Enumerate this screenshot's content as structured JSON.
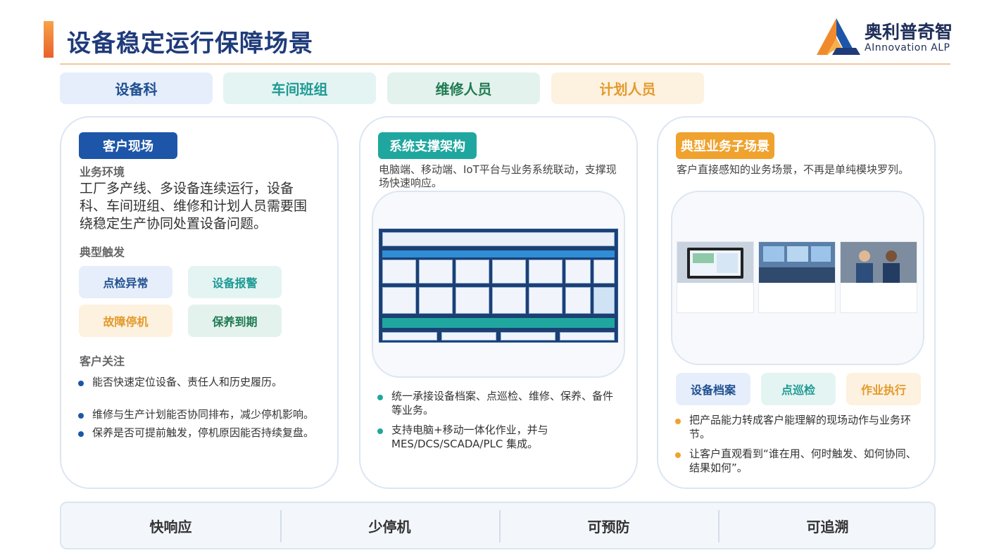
{
  "header": {
    "title": "设备稳定运行保障场景",
    "logo_cn": "奥利普奇智",
    "logo_en": "AInnovation ALP"
  },
  "roles": [
    "设备科",
    "车间班组",
    "维修人员",
    "计划人员"
  ],
  "card1": {
    "badge": "客户现场",
    "env_label": "业务环境",
    "env_text": "工厂多产线、多设备连续运行，设备科、车间班组、维修和计划人员需要围绕稳定生产协同处置设备问题。",
    "trigger_label": "典型触发",
    "triggers": [
      "点检异常",
      "设备报警",
      "故障停机",
      "保养到期"
    ],
    "concern_label": "客户关注",
    "concerns": [
      "能否快速定位设备、责任人和历史履历。",
      "维修与生产计划能否协同排布，减少停机影响。",
      "保养是否可提前触发，停机原因能否持续复盘。"
    ]
  },
  "card2": {
    "badge": "系统支撑架构",
    "desc": "电脑端、移动端、IoT平台与业务系统联动，支撑现场快速响应。",
    "points": [
      "统一承接设备档案、点巡检、维修、保养、备件等业务。",
      "支持电脑+移动一体化作业，并与MES/DCS/SCADA/PLC 集成。"
    ]
  },
  "card3": {
    "badge": "典型业务子场景",
    "desc": "客户直接感知的业务场景，不再是单纯模块罗列。",
    "tags": [
      "设备档案",
      "点巡检",
      "作业执行"
    ],
    "points": [
      "把产品能力转成客户能理解的现场动作与业务环节。",
      "让客户直观看到“谁在用、何时触发、如何协同、结果如何”。"
    ]
  },
  "pillars": [
    "快响应",
    "少停机",
    "可预防",
    "可追溯"
  ],
  "colors": {
    "navy": "#1f3b7a",
    "blue_badge": "#1d56a8",
    "teal_badge": "#1fa79f",
    "orange_badge": "#f0a22e"
  }
}
